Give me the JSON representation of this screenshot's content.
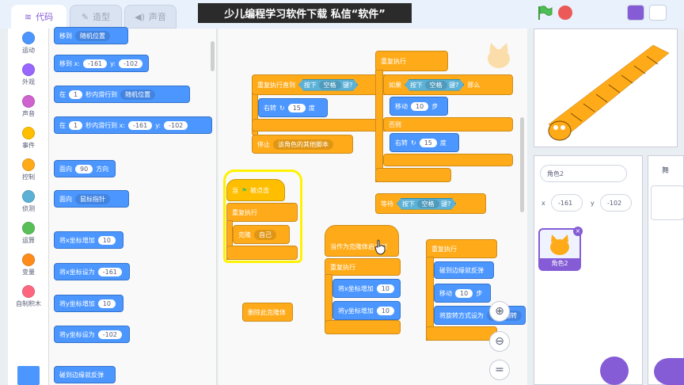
{
  "tabs": {
    "code": "代码",
    "costumes": "造型",
    "sounds": "声音"
  },
  "banner": "少儿编程学习软件下载 私信“软件”",
  "categories": [
    {
      "label": "运动",
      "color": "#4c97ff"
    },
    {
      "label": "外观",
      "color": "#9966ff"
    },
    {
      "label": "声音",
      "color": "#cf63cf"
    },
    {
      "label": "事件",
      "color": "#ffbf00"
    },
    {
      "label": "控制",
      "color": "#ffab19"
    },
    {
      "label": "侦测",
      "color": "#5cb1d6"
    },
    {
      "label": "运算",
      "color": "#59c059"
    },
    {
      "label": "变量",
      "color": "#ff8c1a"
    },
    {
      "label": "自制积木",
      "color": "#ff6680"
    }
  ],
  "palette": {
    "goto": {
      "a": "移到",
      "dd": "随机位置"
    },
    "gotoxy": {
      "a": "移到 x:",
      "x": "-161",
      "b": "y:",
      "y": "-102"
    },
    "glide1": {
      "a": "在",
      "n": "1",
      "b": "秒内滑行到",
      "dd": "随机位置"
    },
    "glide2": {
      "a": "在",
      "n": "1",
      "b": "秒内滑行到 x:",
      "x": "-161",
      "c": "y:",
      "y": "-102"
    },
    "pointdir": {
      "a": "面向",
      "n": "90",
      "b": "方向"
    },
    "pointto": {
      "a": "面向",
      "dd": "鼠标指针"
    },
    "changex": {
      "a": "将x坐标增加",
      "n": "10"
    },
    "setx": {
      "a": "将x坐标设为",
      "n": "-161"
    },
    "changey": {
      "a": "将y坐标增加",
      "n": "10"
    },
    "sety": {
      "a": "将y坐标设为",
      "n": "-102"
    },
    "bounce": "碰到边缘就反弹"
  },
  "script1": {
    "repeat_until": "重复执行直到",
    "key": "按下",
    "keyname": "空格",
    "pressed": "键?",
    "turn": "右转",
    "deg": "15",
    "degunit": "度",
    "stop": "停止",
    "stop_dd": "该角色的其他脚本"
  },
  "script2": {
    "forever": "重复执行",
    "if": "如果",
    "key": "按下",
    "keyname": "空格",
    "pressed": "键?",
    "then": "那么",
    "move": "移动",
    "steps": "10",
    "stepunit": "步",
    "else": "否则",
    "turn": "右转",
    "deg": "15",
    "degunit": "度"
  },
  "script3": {
    "wait": "等待",
    "key": "按下",
    "keyname": "空格",
    "pressed": "键?"
  },
  "script4": {
    "when": "当",
    "clicked": "被点击",
    "forever": "重复执行",
    "clone": "克隆",
    "clone_dd": "自己"
  },
  "script5": {
    "hat": "当作为克隆体启动时",
    "forever": "重复执行",
    "changex": "将x坐标增加",
    "nx": "10",
    "changey": "将y坐标增加",
    "ny": "10"
  },
  "script6": {
    "delete": "删除此克隆体"
  },
  "script7": {
    "forever": "重复执行",
    "bounce": "碰到边缘就反弹",
    "move": "移动",
    "steps": "10",
    "stepunit": "步",
    "rot": "将旋转方式设为",
    "rot_dd": "左右翻转"
  },
  "sprite": {
    "name": "角色2",
    "x_label": "x",
    "x": "-161",
    "y_label": "y",
    "y": "-102",
    "thumb_label": "角色2"
  },
  "stage_label": "舞"
}
